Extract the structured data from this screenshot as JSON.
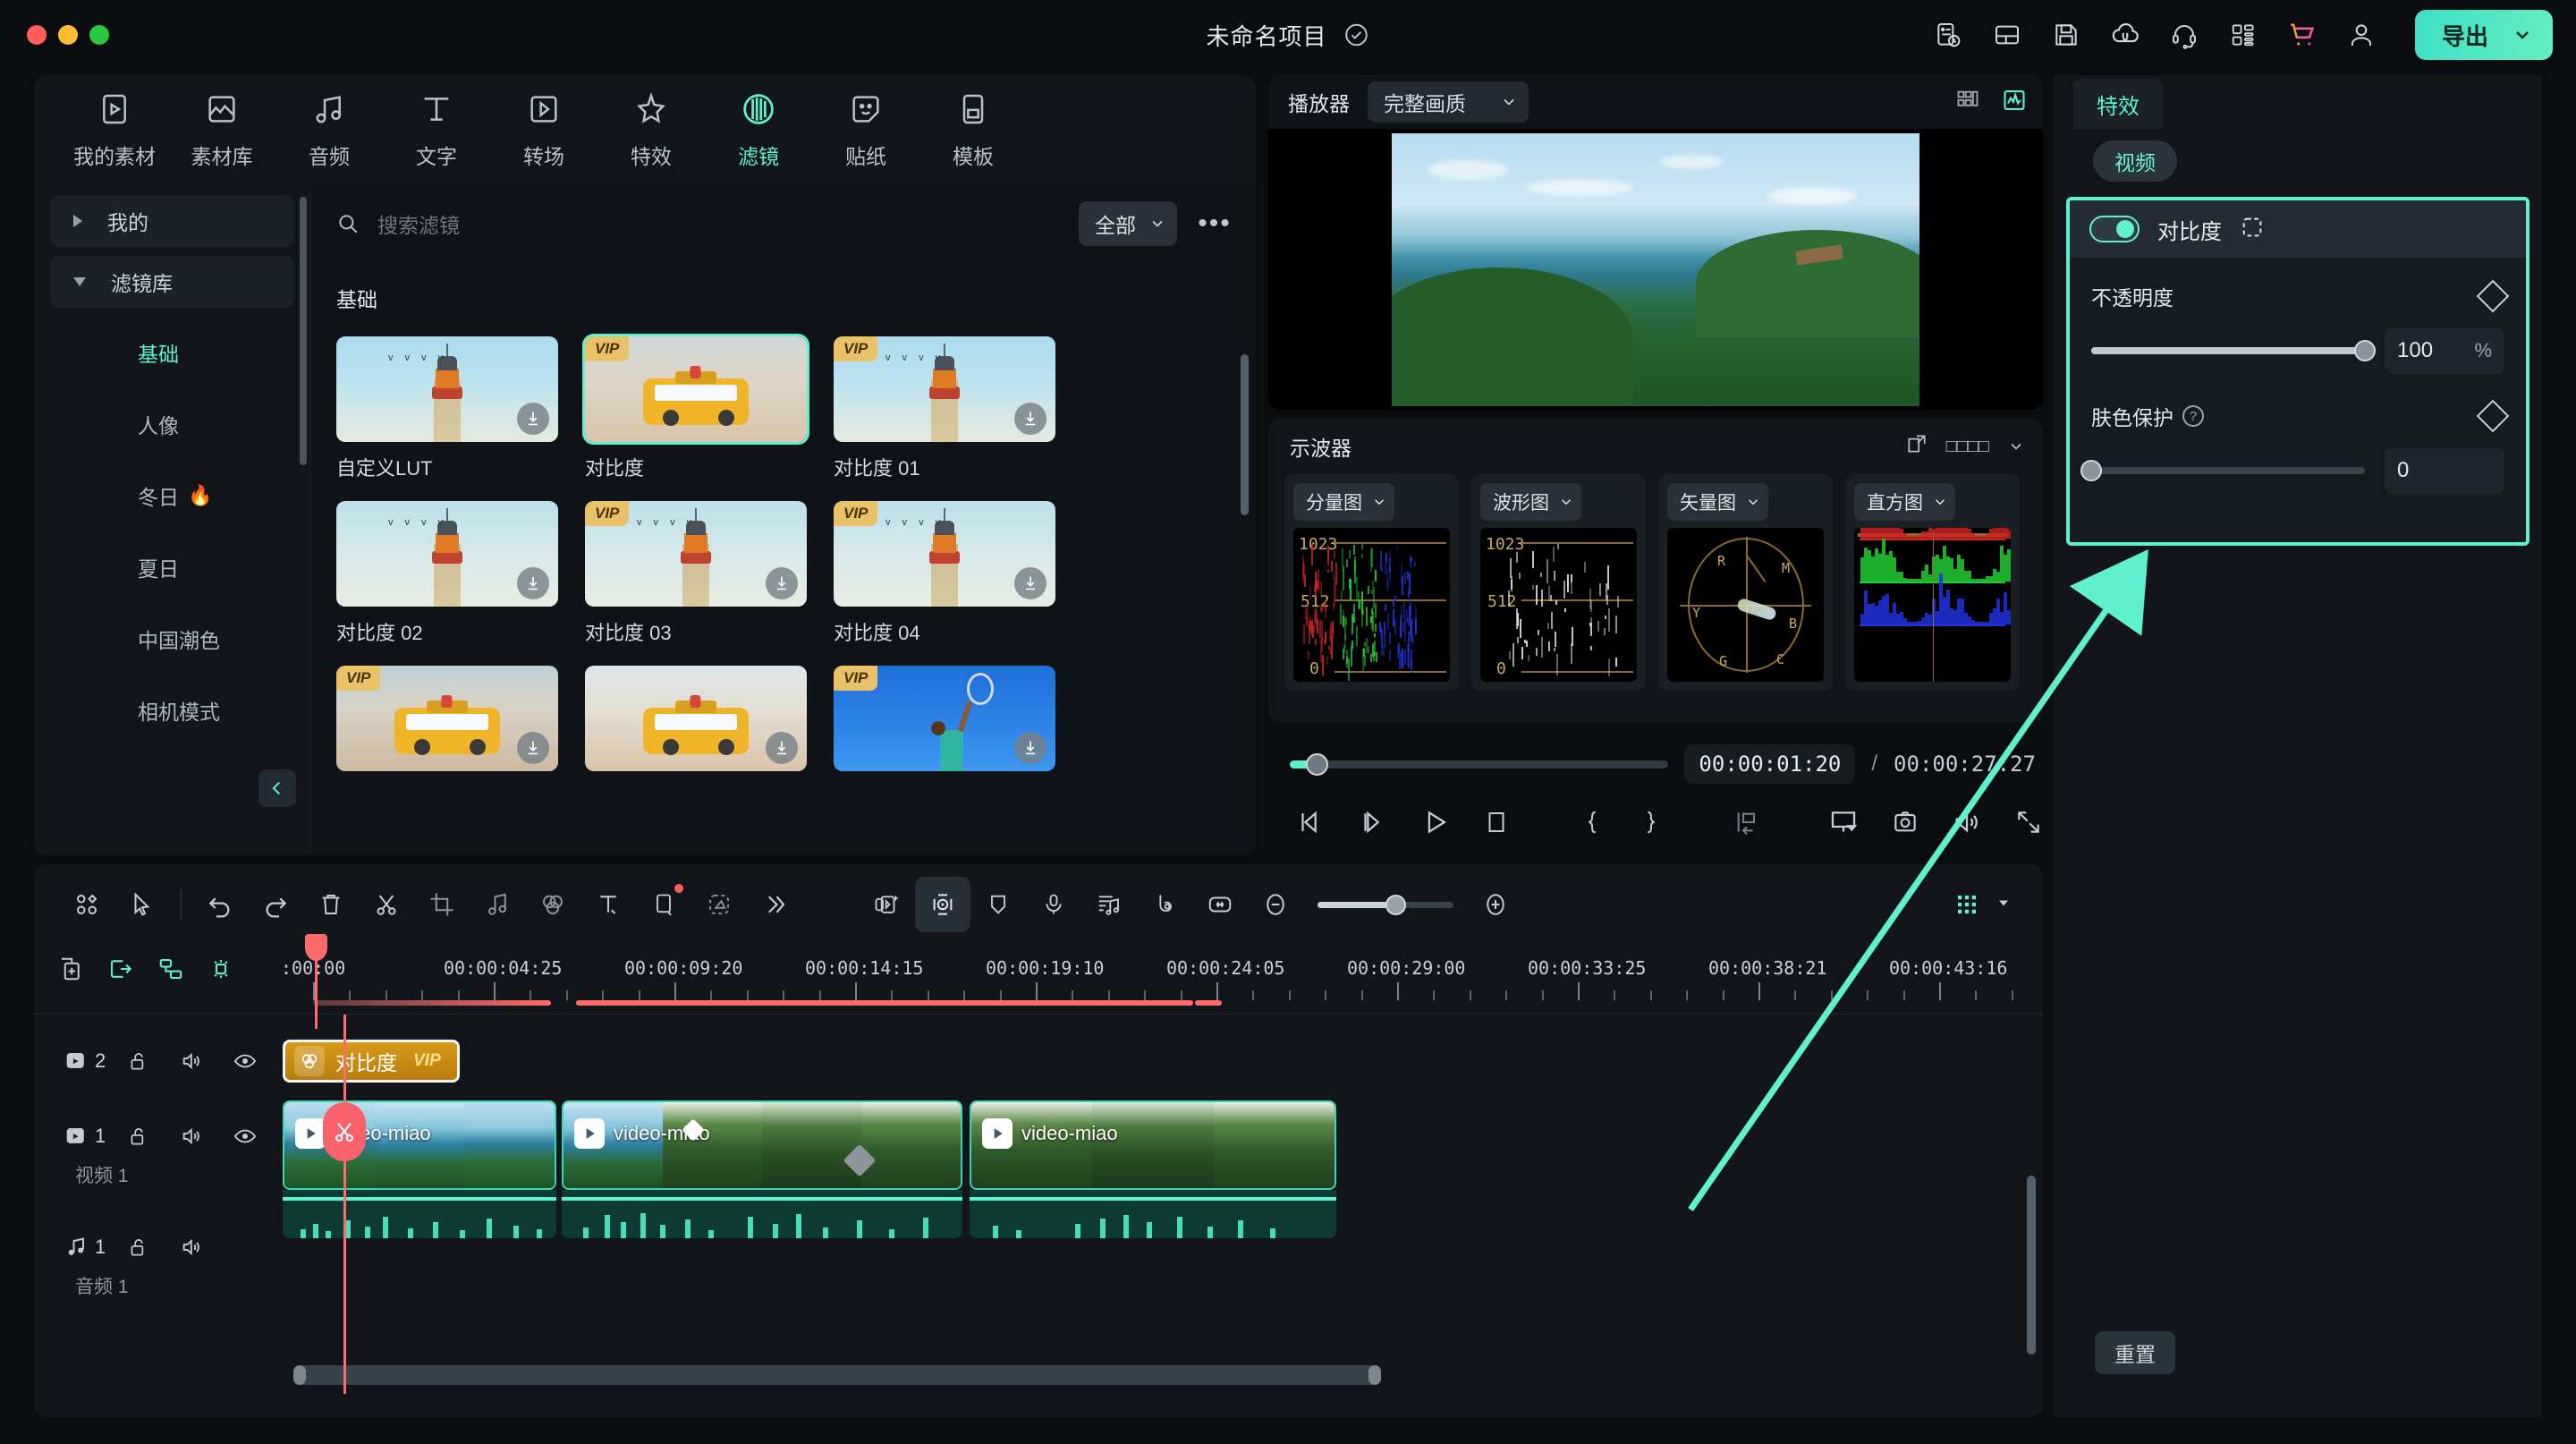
{
  "titlebar": {
    "project_title": "未命名项目",
    "check_icon": "check-circle-icon",
    "right_icons": [
      {
        "name": "version-history-icon"
      },
      {
        "name": "layout-icon"
      },
      {
        "name": "save-icon"
      },
      {
        "name": "cloud-upload-icon"
      },
      {
        "name": "headset-support-icon"
      },
      {
        "name": "apps-grid-icon"
      },
      {
        "name": "shopping-cart-icon"
      },
      {
        "name": "user-account-icon"
      }
    ],
    "export_label": "导出",
    "export_caret": "chevron-down-icon",
    "accent": "#5ff0cd",
    "export_gradient_from": "#3fe0c8",
    "export_gradient_to": "#62eec0"
  },
  "categories": [
    {
      "label": "我的素材",
      "icon": "my-media-icon",
      "active": false
    },
    {
      "label": "素材库",
      "icon": "stock-library-icon",
      "active": false
    },
    {
      "label": "音频",
      "icon": "audio-icon",
      "active": false
    },
    {
      "label": "文字",
      "icon": "text-icon",
      "active": false
    },
    {
      "label": "转场",
      "icon": "transition-icon",
      "active": false
    },
    {
      "label": "特效",
      "icon": "effects-icon",
      "active": false
    },
    {
      "label": "滤镜",
      "icon": "filter-icon",
      "active": true
    },
    {
      "label": "贴纸",
      "icon": "sticker-icon",
      "active": false
    },
    {
      "label": "模板",
      "icon": "template-icon",
      "active": false
    }
  ],
  "tree": {
    "groups": [
      {
        "label": "我的",
        "expanded": false
      },
      {
        "label": "滤镜库",
        "expanded": true
      }
    ],
    "items": [
      {
        "label": "基础",
        "active": true,
        "badge": ""
      },
      {
        "label": "人像",
        "active": false,
        "badge": ""
      },
      {
        "label": "冬日",
        "active": false,
        "badge": "🔥"
      },
      {
        "label": "夏日",
        "active": false,
        "badge": ""
      },
      {
        "label": "中国潮色",
        "active": false,
        "badge": ""
      },
      {
        "label": "相机模式",
        "active": false,
        "badge": ""
      }
    ],
    "collapse_icon": "chevron-left-icon"
  },
  "search": {
    "icon": "search-icon",
    "placeholder": "搜索滤镜",
    "value": "",
    "filter_label": "全部",
    "filter_caret": "chevron-down-icon",
    "more_icon": "more-horizontal-icon"
  },
  "filter_grid": {
    "section_title": "基础",
    "items": [
      {
        "name": "自定义LUT",
        "vip": false,
        "downloadable": true,
        "selected": false,
        "art": "lh"
      },
      {
        "name": "对比度",
        "vip": true,
        "downloadable": false,
        "selected": true,
        "art": "bus"
      },
      {
        "name": "对比度 01",
        "vip": true,
        "downloadable": true,
        "selected": false,
        "art": "lh"
      },
      {
        "name": "对比度 02",
        "vip": false,
        "downloadable": true,
        "selected": false,
        "art": "lh2"
      },
      {
        "name": "对比度 03",
        "vip": true,
        "downloadable": true,
        "selected": false,
        "art": "lh2"
      },
      {
        "name": "对比度 04",
        "vip": true,
        "downloadable": true,
        "selected": false,
        "art": "lh2"
      },
      {
        "name": "",
        "vip": true,
        "downloadable": true,
        "selected": false,
        "art": "bus2"
      },
      {
        "name": "",
        "vip": false,
        "downloadable": true,
        "selected": false,
        "art": "bus3"
      },
      {
        "name": "",
        "vip": true,
        "downloadable": true,
        "selected": false,
        "art": "ten"
      }
    ],
    "vip_label": "VIP"
  },
  "player": {
    "label": "播放器",
    "quality": "完整画质",
    "quality_caret": "chevron-down-icon",
    "grid_icon": "layout-grid-icon",
    "scope_icon": "waveform-scope-icon"
  },
  "scopes": {
    "title": "示波器",
    "popout_icon": "popout-icon",
    "menu_label": "□□□□",
    "menu_caret": "chevron-down-icon",
    "panels": [
      {
        "label": "分量图",
        "caret": "chevron-down-icon",
        "top": "1023",
        "mid": "512",
        "bottom": "0",
        "kind": "rgb-parade"
      },
      {
        "label": "波形图",
        "caret": "chevron-down-icon",
        "top": "1023",
        "mid": "512",
        "bottom": "0",
        "kind": "waveform"
      },
      {
        "label": "矢量图",
        "caret": "chevron-down-icon",
        "kind": "vectorscope",
        "marks": [
          "R",
          "M",
          "B",
          "C",
          "G",
          "Y"
        ]
      },
      {
        "label": "直方图",
        "caret": "chevron-down-icon",
        "kind": "histogram"
      }
    ]
  },
  "transport": {
    "current_time": "00:00:01:20",
    "separator": "/",
    "total_time": "00:00:27:27",
    "progress_percent": 3,
    "buttons": [
      {
        "name": "prev-frame-button",
        "icon": "prev-frame-icon"
      },
      {
        "name": "next-frame-button",
        "icon": "next-frame-icon"
      },
      {
        "name": "play-button",
        "icon": "play-icon"
      },
      {
        "name": "stop-button",
        "icon": "stop-icon"
      },
      {
        "name": "mark-in-button",
        "icon": "brace-left-icon"
      },
      {
        "name": "mark-out-button",
        "icon": "brace-right-icon"
      },
      {
        "name": "insert-button",
        "icon": "insert-icon"
      },
      {
        "name": "insert-caret",
        "icon": "chevron-down-icon"
      },
      {
        "name": "display-button",
        "icon": "monitor-icon"
      },
      {
        "name": "snapshot-button",
        "icon": "camera-icon"
      },
      {
        "name": "volume-button",
        "icon": "speaker-icon"
      },
      {
        "name": "fullscreen-button",
        "icon": "expand-icon"
      }
    ]
  },
  "properties": {
    "tab_label": "特效",
    "chip_label": "视频",
    "effect": {
      "enabled": true,
      "name": "对比度",
      "mask_icon": "mask-selection-icon",
      "rows": [
        {
          "label": "不透明度",
          "value": "100",
          "unit": "%",
          "percent": 100,
          "keyframe_icon": "keyframe-diamond-icon",
          "has_help": false
        },
        {
          "label": "肤色保护",
          "value": "0",
          "unit": "",
          "percent": 0,
          "keyframe_icon": "keyframe-diamond-icon",
          "has_help": true,
          "help_icon": "help-circle-icon"
        }
      ]
    },
    "reset_label": "重置",
    "highlight_color": "#5ff0cd"
  },
  "timeline_toolbar": {
    "left_buttons": [
      {
        "name": "marker-panel-button",
        "icon": "marker-grid-icon",
        "active": false
      },
      {
        "name": "select-tool-button",
        "icon": "cursor-arrow-icon",
        "active": false
      },
      {
        "name": "undo-button",
        "icon": "undo-icon",
        "active": false
      },
      {
        "name": "redo-button",
        "icon": "redo-icon",
        "active": false
      },
      {
        "name": "delete-button",
        "icon": "trash-icon",
        "active": false
      },
      {
        "name": "split-button",
        "icon": "scissors-icon",
        "active": false
      },
      {
        "name": "crop-button",
        "icon": "crop-icon",
        "active": false
      },
      {
        "name": "audio-detach-button",
        "icon": "music-note-icon",
        "active": false
      },
      {
        "name": "color-button",
        "icon": "color-circles-icon",
        "active": false
      },
      {
        "name": "text-button",
        "icon": "text-tool-icon",
        "active": false
      },
      {
        "name": "mask-button",
        "icon": "mask-rect-icon",
        "active": false,
        "badge": true
      },
      {
        "name": "sticker-tool-button",
        "icon": "sticker-dashed-icon",
        "active": false
      },
      {
        "name": "more-tools-button",
        "icon": "chevrons-right-icon",
        "active": false
      }
    ],
    "right_buttons": [
      {
        "name": "ai-tools-button",
        "icon": "ai-magic-icon",
        "active": false
      },
      {
        "name": "keyframe-button",
        "icon": "keyframe-capsule-icon",
        "active": true
      },
      {
        "name": "marker-button",
        "icon": "shield-marker-icon",
        "active": false
      },
      {
        "name": "record-voice-button",
        "icon": "microphone-icon",
        "active": false
      },
      {
        "name": "audio-mixer-button",
        "icon": "audio-list-icon",
        "active": false
      },
      {
        "name": "speed-button",
        "icon": "speed-meter-icon",
        "active": false
      },
      {
        "name": "fit-button",
        "icon": "fit-horizontal-icon",
        "active": false
      }
    ],
    "zoom_out_icon": "minus-circle-icon",
    "zoom_in_icon": "plus-circle-icon",
    "zoom_percent": 56,
    "track_menu_icon": "track-dots-icon",
    "track_menu_caret": "caret-down-icon"
  },
  "ruler": {
    "tools": [
      {
        "name": "add-track-button",
        "icon": "add-track-icon",
        "accent": false
      },
      {
        "name": "link-clip-button",
        "icon": "link-in-icon",
        "accent": true
      },
      {
        "name": "group-button",
        "icon": "group-icon",
        "accent": true
      },
      {
        "name": "marker-flash-button",
        "icon": "marker-flash-icon",
        "accent": true
      }
    ],
    "ticks": [
      ":00:00",
      "00:00:04:25",
      "00:00:09:20",
      "00:00:14:15",
      "00:00:19:10",
      "00:00:24:05",
      "00:00:29:00",
      "00:00:33:25",
      "00:00:38:21",
      "00:00:43:16"
    ]
  },
  "tracks": [
    {
      "name": "video-track-2",
      "type": "video",
      "icon": "video-track-icon",
      "number": "2",
      "label": "",
      "lock_icon": "unlock-icon",
      "mute_icon": "speaker-icon",
      "eye_icon": "eye-icon",
      "clips": [
        {
          "kind": "effect",
          "label": "对比度",
          "vip_label": "VIP",
          "icon": "color-circles-icon",
          "selected": true
        }
      ]
    },
    {
      "name": "video-track-1",
      "type": "video",
      "icon": "video-track-icon",
      "number": "1",
      "label": "视频 1",
      "lock_icon": "unlock-icon",
      "mute_icon": "speaker-icon",
      "eye_icon": "eye-icon",
      "clips": [
        {
          "kind": "video",
          "label": "video-miao"
        },
        {
          "kind": "video",
          "label": "video-miao"
        },
        {
          "kind": "video",
          "label": "video-miao"
        }
      ]
    },
    {
      "name": "audio-track-1",
      "type": "audio",
      "icon": "audio-track-icon",
      "number": "1",
      "label": "音频 1",
      "lock_icon": "unlock-icon",
      "mute_icon": "speaker-icon",
      "eye_icon": "",
      "clips": []
    }
  ],
  "playhead": {
    "cut_icon": "scissors-icon",
    "position_label": "00:00:01:20"
  },
  "annotation": {
    "arrow_color": "#5ff0cd",
    "description": "arrow pointing to contrast effect properties"
  }
}
